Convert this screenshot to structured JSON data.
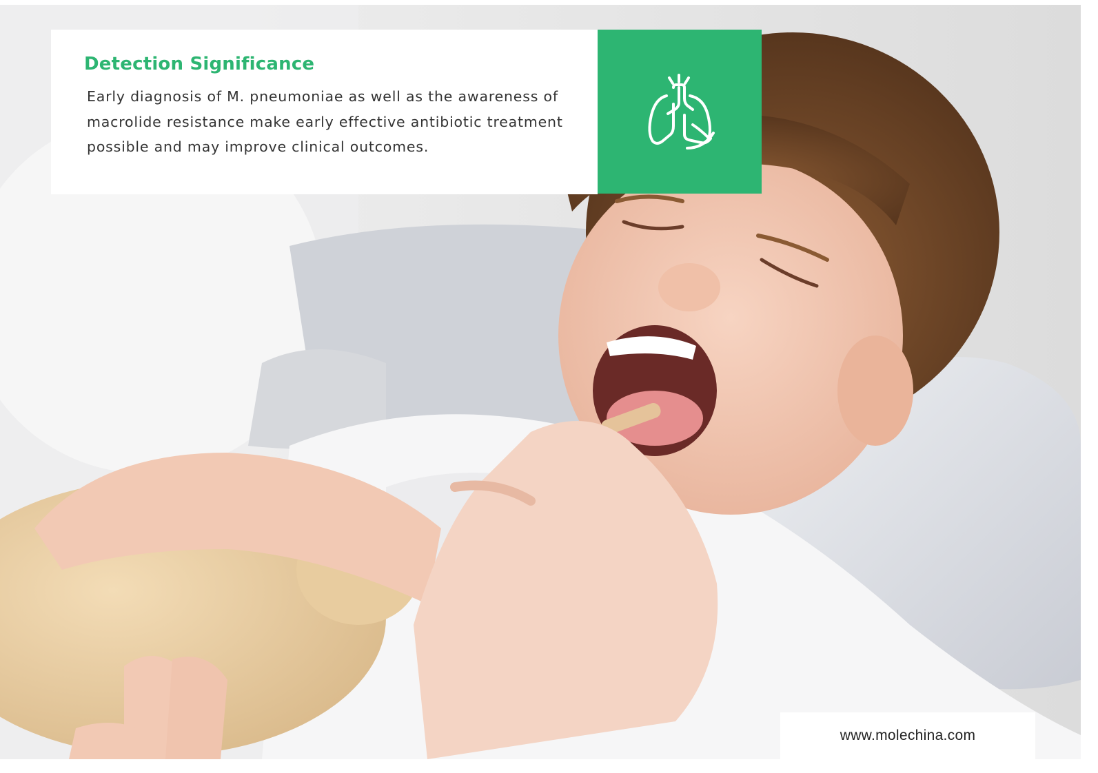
{
  "info": {
    "title": "Detection Significance",
    "body": "Early diagnosis of M. pneumoniae as well as the awareness of macrolide resistance make early effective antibiotic treatment possible and may improve clinical outcomes."
  },
  "icon": {
    "name": "lungs-icon",
    "background": "#2db572",
    "stroke": "#ffffff"
  },
  "footer": {
    "url": "www.molechina.com"
  },
  "colors": {
    "accent": "#2db572",
    "text": "#333333"
  }
}
